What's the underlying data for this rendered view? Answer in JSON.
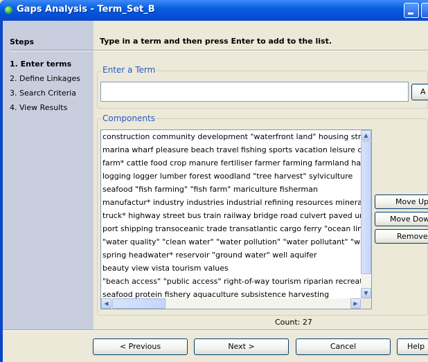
{
  "window": {
    "title": "Gaps Analysis - Term_Set_B"
  },
  "steps": {
    "heading": "Steps",
    "items": [
      {
        "label": "1. Enter terms",
        "active": true
      },
      {
        "label": "2. Define Linkages",
        "active": false
      },
      {
        "label": "3. Search Criteria",
        "active": false
      },
      {
        "label": "4. View Results",
        "active": false
      }
    ]
  },
  "main": {
    "instruction": "Type in a term and then press Enter to add to the list.",
    "term_group": {
      "title": "Enter a Term",
      "value": "",
      "add_button": "A"
    },
    "components_group": {
      "title": "Components",
      "items": [
        "construction community development \"waterfront land\" housing street",
        "marina wharf pleasure beach travel fishing sports vacation leisure co",
        "farm* cattle food crop manure fertiliser farmer farming farmland harv",
        "logging logger lumber forest woodland \"tree harvest\" sylviculture",
        "seafood \"fish farming\" \"fish farm\" mariculture fisherman",
        "manufactur* industry industries industrial refining resources mineral",
        "truck* highway street bus train railway bridge road culvert paved ur",
        "port shipping transoceanic trade transatlantic cargo ferry \"ocean line",
        "\"water quality\" \"clean water\" \"water pollution\" \"water pollutant\" \"wat",
        "spring headwater* reservoir \"ground water\" well aquifer",
        "beauty view vista tourism values",
        "\"beach access\" \"public access\" right-of-way tourism riparian recreatio",
        "seafood protein fishery aquaculture subsistence harvesting"
      ],
      "count_text": "Count: 27"
    },
    "side_buttons": {
      "move_up": "Move Up",
      "move_down": "Move Down",
      "remove": "Remove"
    }
  },
  "footer": {
    "previous": "< Previous",
    "next": "Next >",
    "cancel": "Cancel",
    "help": "Help"
  }
}
